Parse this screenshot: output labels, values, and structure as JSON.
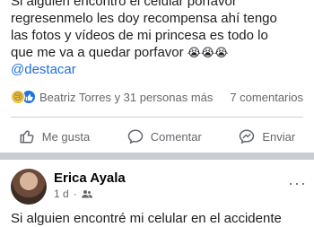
{
  "post": {
    "lines": [
      "Si alguien encontró el celular porfavor",
      "regresenmelo les doy recompensa ahí tengo",
      "las fotos y vídeos de mi princesa es todo lo",
      "que me va a quedar porfavor"
    ],
    "emojis": "😭😭😭",
    "mention": "@destacar"
  },
  "reactions": {
    "icons": [
      "sad-emoji",
      "like-thumb"
    ],
    "names": "Beatriz Torres y 31 personas más",
    "comments": "7 comentarios"
  },
  "actions": [
    {
      "label": "Me gusta",
      "icon": "like-icon"
    },
    {
      "label": "Comentar",
      "icon": "comment-icon"
    },
    {
      "label": "Enviar",
      "icon": "share-icon"
    }
  ],
  "comment": {
    "name": "Erica Ayala",
    "time": "1 d",
    "audience": "friends-icon",
    "text": "Si alguien encontré mi celular en el accidente"
  },
  "colors": {
    "mention": "#216fdb",
    "like_blue": "#1b74e4",
    "muted_text": "#65676b",
    "divider": "#ced0d4"
  }
}
